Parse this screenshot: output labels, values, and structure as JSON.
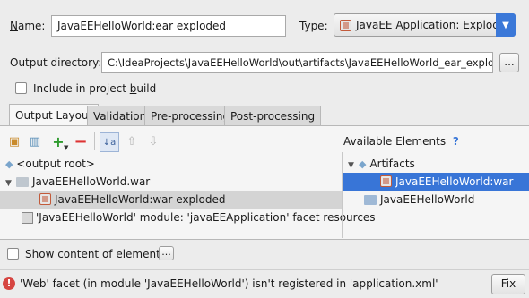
{
  "form": {
    "name_label": "Name:",
    "name_value": "JavaEEHelloWorld:ear exploded",
    "type_label": "Type:",
    "type_value": "JavaEE Application: Exploded",
    "output_dir_label": "Output directory:",
    "output_dir_value": "C:\\IdeaProjects\\JavaEEHelloWorld\\out\\artifacts\\JavaEEHelloWorld_ear_exploded",
    "browse_label": "...",
    "include_label_pre": "Include in project ",
    "include_label_u": "b",
    "include_label_post": "uild"
  },
  "tabs": [
    {
      "label": "Output Layout",
      "selected": true
    },
    {
      "label": "Validation",
      "selected": false
    },
    {
      "label": "Pre-processing",
      "selected": false
    },
    {
      "label": "Post-processing",
      "selected": false
    }
  ],
  "layout_tree": [
    {
      "label": "<output root>",
      "icon": "output-root-icon",
      "expanded": false
    },
    {
      "label": "JavaEEHelloWorld.war",
      "icon": "folder-icon",
      "expanded": true
    },
    {
      "label": "JavaEEHelloWorld:war exploded",
      "icon": "artifact-icon",
      "selected": true
    },
    {
      "label": "'JavaEEHelloWorld' module: 'javaEEApplication' facet resources",
      "icon": "module-resources-icon"
    }
  ],
  "available": {
    "title": "Available Elements",
    "help": "?",
    "items": [
      {
        "label": "Artifacts",
        "icon": "artifacts-icon",
        "expanded": true
      },
      {
        "label": "JavaEEHelloWorld:war",
        "icon": "artifact-icon",
        "selected": true
      },
      {
        "label": "JavaEEHelloWorld",
        "icon": "module-icon"
      }
    ]
  },
  "bottom": {
    "show_content_label": "Show content of elements",
    "show_content_more": "...",
    "error_text": "'Web' facet (in module 'JavaEEHelloWorld') isn't registered in 'application.xml'",
    "fix_label": "Fix"
  },
  "colors": {
    "selection": "#3875d7",
    "selection_inactive": "#d4d4d4",
    "accent": "#3b78d8"
  }
}
